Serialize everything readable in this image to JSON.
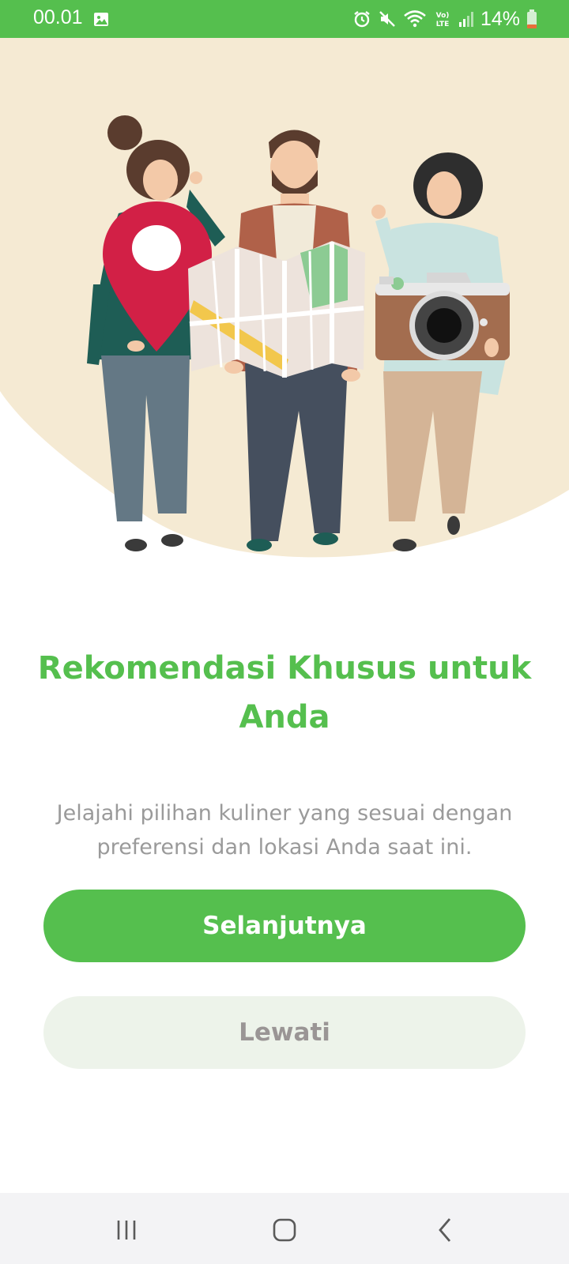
{
  "status_bar": {
    "time": "00.01",
    "battery": "14%",
    "icons": [
      "gallery-icon",
      "alarm-icon",
      "mute-icon",
      "wifi-icon",
      "volte-icon",
      "signal-icon",
      "battery-icon"
    ]
  },
  "hero": {
    "illustration": "travelers-with-map-pin-map-camera"
  },
  "onboarding": {
    "title": "Rekomendasi Khusus untuk Anda",
    "description": "Jelajahi pilihan kuliner yang sesuai dengan preferensi dan lokasi Anda saat ini.",
    "next_label": "Selanjutnya",
    "skip_label": "Lewati"
  },
  "colors": {
    "accent": "#55bf4e",
    "hero_bg": "#f5ead3",
    "skip_bg": "#edf3ea",
    "text_muted": "#9a9a9a"
  },
  "nav_bar": {
    "icons": [
      "recents-icon",
      "home-icon",
      "back-icon"
    ]
  }
}
